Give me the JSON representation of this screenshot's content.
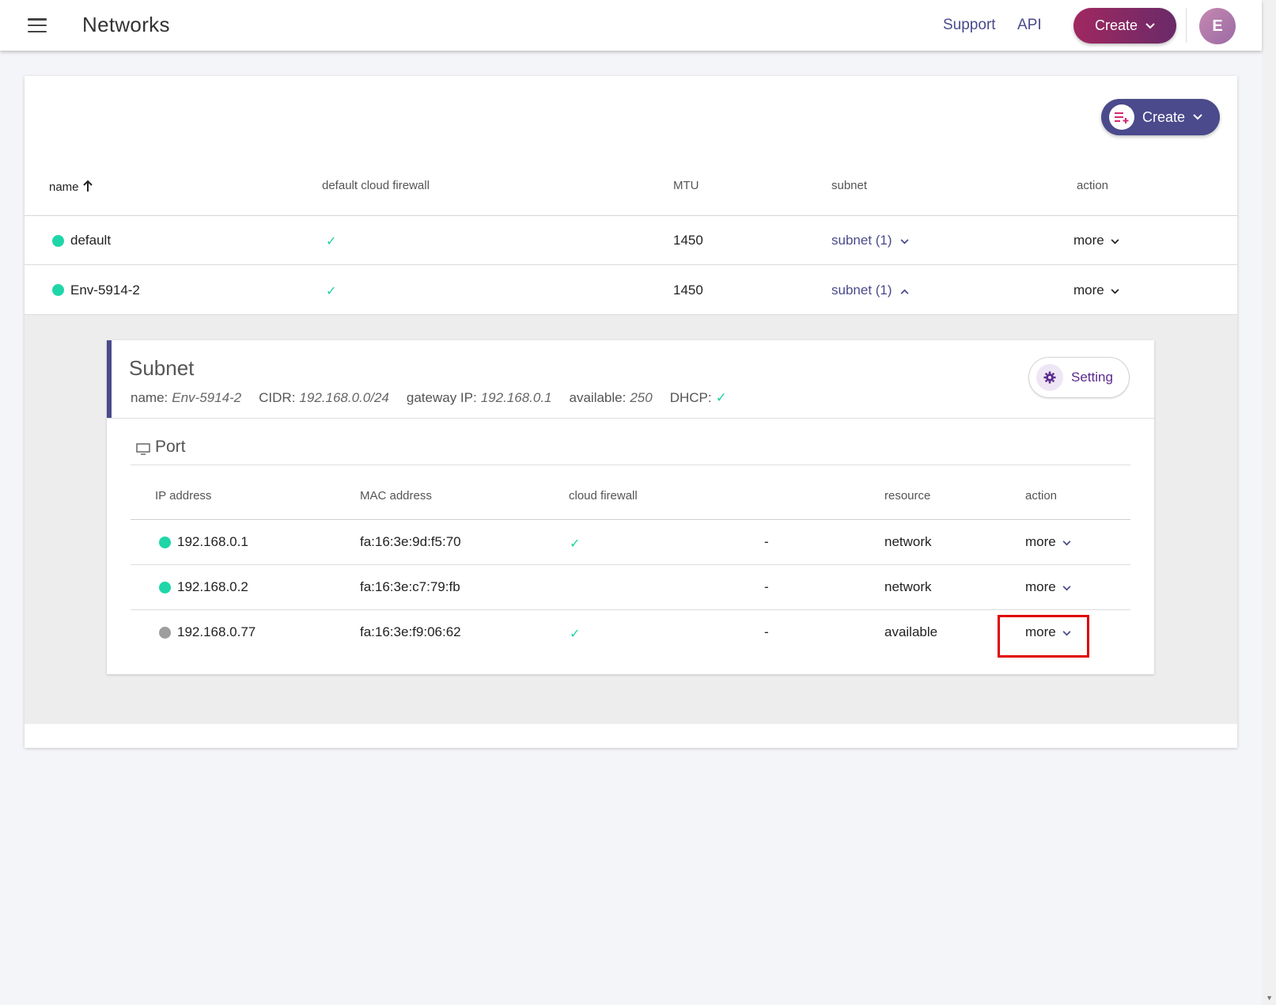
{
  "topbar": {
    "title": "Networks",
    "support": "Support",
    "api": "API",
    "create": "Create",
    "avatar_initial": "E"
  },
  "card": {
    "create": "Create"
  },
  "table": {
    "headers": {
      "name": "name",
      "firewall": "default cloud firewall",
      "mtu": "MTU",
      "subnet": "subnet",
      "action": "action"
    },
    "rows": [
      {
        "name": "default",
        "status_color": "#1fd6a8",
        "firewall": "✓",
        "mtu": "1450",
        "subnet": "subnet (1)",
        "action": "more"
      },
      {
        "name": "Env-5914-2",
        "status_color": "#1fd6a8",
        "firewall": "✓",
        "mtu": "1450",
        "subnet": "subnet (1)",
        "action": "more"
      }
    ]
  },
  "subnet": {
    "title": "Subnet",
    "name_label": "name:",
    "name_value": "Env-5914-2",
    "cidr_label": "CIDR:",
    "cidr_value": "192.168.0.0/24",
    "gateway_label": "gateway IP:",
    "gateway_value": "192.168.0.1",
    "available_label": "available:",
    "available_value": "250",
    "dhcp_label": "DHCP:",
    "dhcp_value": "✓",
    "setting": "Setting"
  },
  "port": {
    "title": "Port",
    "headers": {
      "ip": "IP address",
      "mac": "MAC address",
      "firewall": "cloud firewall",
      "resource": "resource",
      "action": "action"
    },
    "rows": [
      {
        "ip": "192.168.0.1",
        "status_color": "#1fd6a8",
        "mac": "fa:16:3e:9d:f5:70",
        "firewall": "✓",
        "dash": "-",
        "resource": "network",
        "action": "more"
      },
      {
        "ip": "192.168.0.2",
        "status_color": "#1fd6a8",
        "mac": "fa:16:3e:c7:79:fb",
        "firewall": "",
        "dash": "-",
        "resource": "network",
        "action": "more"
      },
      {
        "ip": "192.168.0.77",
        "status_color": "#9e9e9e",
        "mac": "fa:16:3e:f9:06:62",
        "firewall": "✓",
        "dash": "-",
        "resource": "available",
        "action": "more"
      }
    ]
  },
  "colors": {
    "primary": "#4a4a8c",
    "active_status": "#1fd6a8",
    "inactive_status": "#9e9e9e",
    "highlight": "#e00000"
  }
}
